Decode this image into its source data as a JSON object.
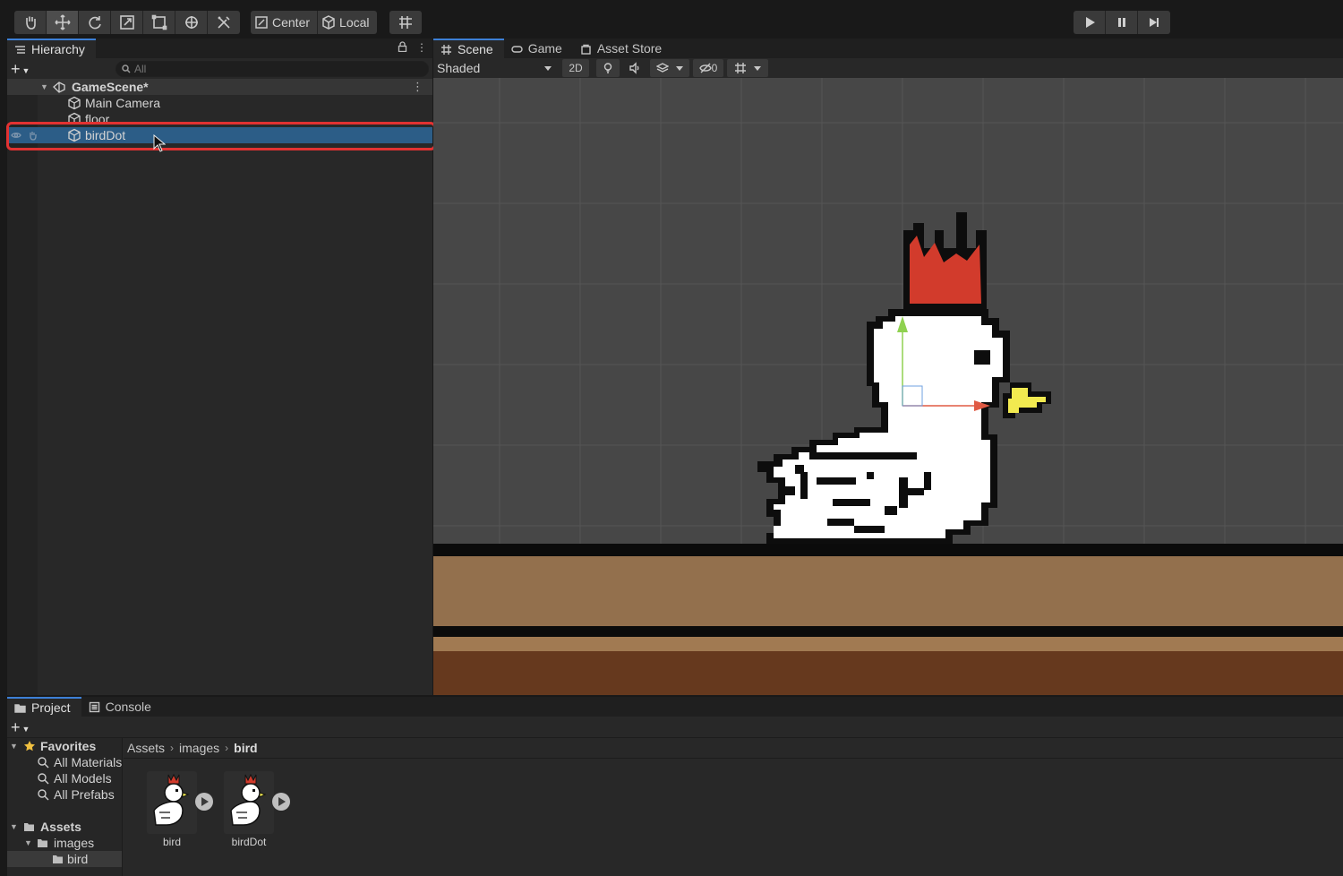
{
  "toolbar": {
    "tools": [
      "hand-tool",
      "move-tool",
      "rotate-tool",
      "scale-tool",
      "rect-tool",
      "transform-tool",
      "custom-tool"
    ],
    "active_tool": "move-tool",
    "pivot_center_label": "Center",
    "pivot_local_label": "Local"
  },
  "hierarchy": {
    "tab_label": "Hierarchy",
    "search_placeholder": "All",
    "scene_name": "GameScene*",
    "items": [
      {
        "label": "Main Camera"
      },
      {
        "label": "floor"
      },
      {
        "label": "birdDot",
        "selected": true
      }
    ]
  },
  "scene": {
    "tabs": [
      {
        "label": "Scene",
        "active": true
      },
      {
        "label": "Game"
      },
      {
        "label": "Asset Store"
      }
    ],
    "shading_mode": "Shaded",
    "mode_2d_label": "2D",
    "hidden_count": "0"
  },
  "bottom": {
    "tabs": [
      {
        "label": "Project",
        "active": true
      },
      {
        "label": "Console"
      }
    ],
    "tree": {
      "favorites_label": "Favorites",
      "favorites": [
        "All Materials",
        "All Models",
        "All Prefabs"
      ],
      "assets_label": "Assets",
      "images_label": "images",
      "bird_label": "bird"
    },
    "breadcrumb": [
      "Assets",
      "images",
      "bird"
    ],
    "assets": [
      {
        "label": "bird"
      },
      {
        "label": "birdDot"
      }
    ]
  },
  "colors": {
    "selection": "#2c5d87",
    "highlight": "#e23232",
    "accent_tab": "#3d80d6",
    "floor_light": "#93704d",
    "floor_dark": "#66391e"
  }
}
